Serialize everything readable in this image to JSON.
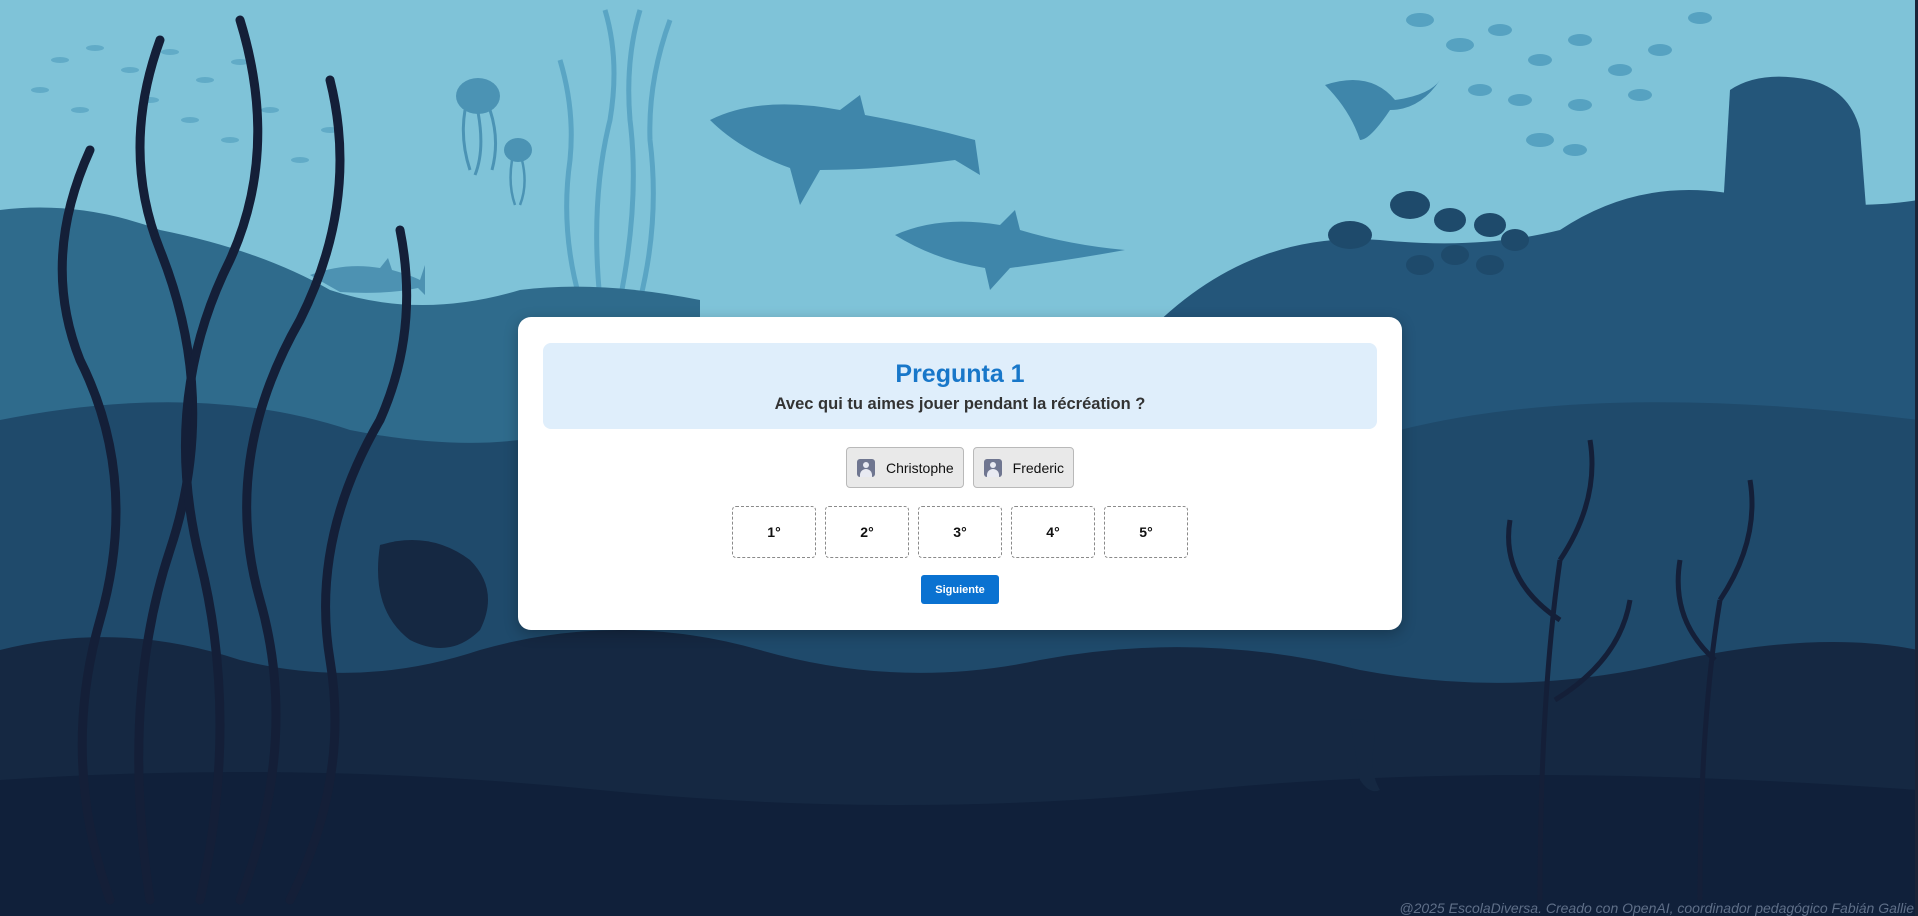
{
  "question": {
    "title": "Pregunta 1",
    "text": "Avec qui tu aimes jouer pendant la récréation ?"
  },
  "names": [
    {
      "label": "Christophe",
      "icon": "user-icon"
    },
    {
      "label": "Frederic",
      "icon": "user-icon"
    }
  ],
  "slots": [
    "1°",
    "2°",
    "3°",
    "4°",
    "5°"
  ],
  "next_button": {
    "label": "Siguiente"
  },
  "footer": {
    "text": "@2025 EscolaDiversa. Creado con OpenAI, coordinador pedagógico Fabián Gallie"
  },
  "colors": {
    "water_light": "#7fc3d8",
    "accent": "#1877c9",
    "button": "#0a72d1",
    "question_bg": "#dfeefb"
  }
}
